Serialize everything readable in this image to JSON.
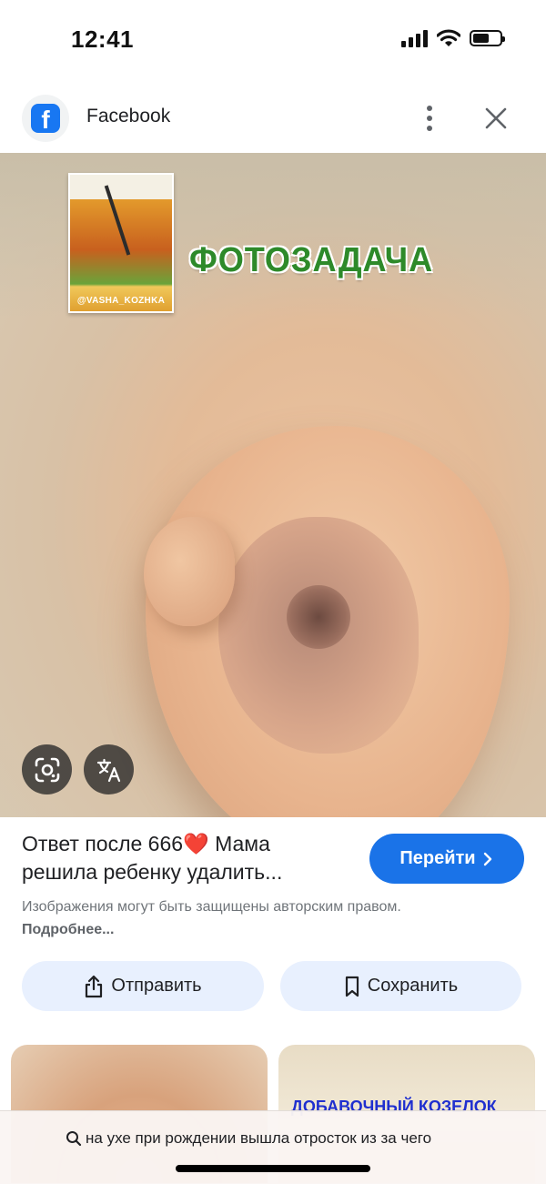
{
  "status_bar": {
    "time": "12:41",
    "icons": [
      "cellular-signal-icon",
      "wifi-icon",
      "battery-icon"
    ],
    "battery_level": 0.6
  },
  "header": {
    "source_icon": "facebook-logo-icon",
    "source_name": "Facebook",
    "more_icon": "more-vertical-icon",
    "close_icon": "close-icon"
  },
  "main_image": {
    "overlay_title": "ФОТОЗАДАЧА",
    "watermark_handle": "@VASHA_KOZHKA",
    "lens_icon": "google-lens-icon",
    "translate_icon": "translate-icon"
  },
  "result": {
    "title": "Ответ после 666❤️ Мама решила ребенку удалить...",
    "go_button_label": "Перейти",
    "go_button_icon": "chevron-right-icon",
    "copyright_text": "Изображения могут быть защищены авторским правом.",
    "more_link_label": "Подробнее..."
  },
  "actions": {
    "share_label": "Отправить",
    "share_icon": "share-icon",
    "save_label": "Сохранить",
    "save_icon": "bookmark-icon"
  },
  "related": {
    "second_thumb_text": "ДОБАВОЧНЫЙ КОЗЕЛОК"
  },
  "search_bar": {
    "query": "на ухе при рождении вышла отросток из за чего",
    "icon": "search-icon"
  },
  "colors": {
    "accent": "#1a73e8",
    "pill_background": "#e8f0fe",
    "facebook_blue": "#1877f2",
    "title_green": "#2e8a2a"
  }
}
